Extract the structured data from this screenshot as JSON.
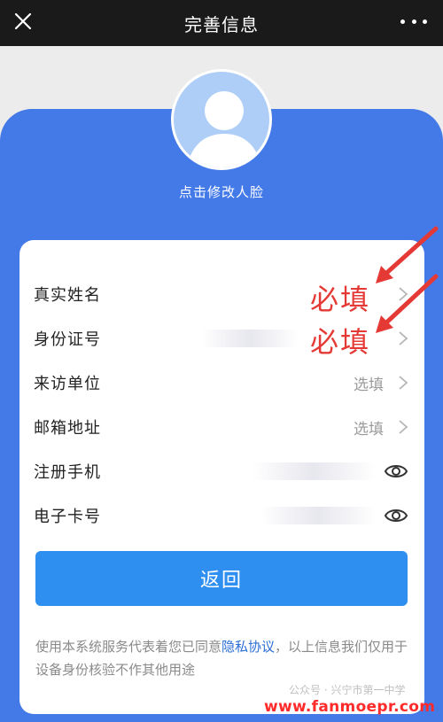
{
  "header": {
    "title": "完善信息",
    "close_icon": "close-icon",
    "more_icon": "more-icon"
  },
  "avatar": {
    "caption": "点击修改人脸",
    "icon": "person-silhouette-icon"
  },
  "form": {
    "rows": [
      {
        "label": "真实姓名",
        "value": "",
        "accessory": "chevron-right-icon"
      },
      {
        "label": "身份证号",
        "value": "",
        "accessory": "chevron-right-icon"
      },
      {
        "label": "来访单位",
        "value": "选填",
        "accessory": "chevron-right-icon"
      },
      {
        "label": "邮箱地址",
        "value": "选填",
        "accessory": "chevron-right-icon"
      },
      {
        "label": "注册手机",
        "value": "",
        "accessory": "eye-icon"
      },
      {
        "label": "电子卡号",
        "value": "",
        "accessory": "eye-icon"
      }
    ],
    "back_button": "返回",
    "notice_prefix": "使用本系统服务代表着您已同意",
    "notice_link": "隐私协议",
    "notice_suffix": "，以上信息我们仅用于设备身份核验不作其他用途"
  },
  "annotations": {
    "required_1": "必填",
    "required_2": "必填",
    "color": "#e53935"
  },
  "watermark": {
    "sub": "公众号 · 兴宁市第一中学",
    "url": "www.fanmoepr.com"
  },
  "colors": {
    "topbar": "#1a1a1a",
    "panel_blue": "#4479e8",
    "button_blue": "#2f8ff0",
    "link": "#2b6fd6",
    "annotation_red": "#e53935"
  }
}
